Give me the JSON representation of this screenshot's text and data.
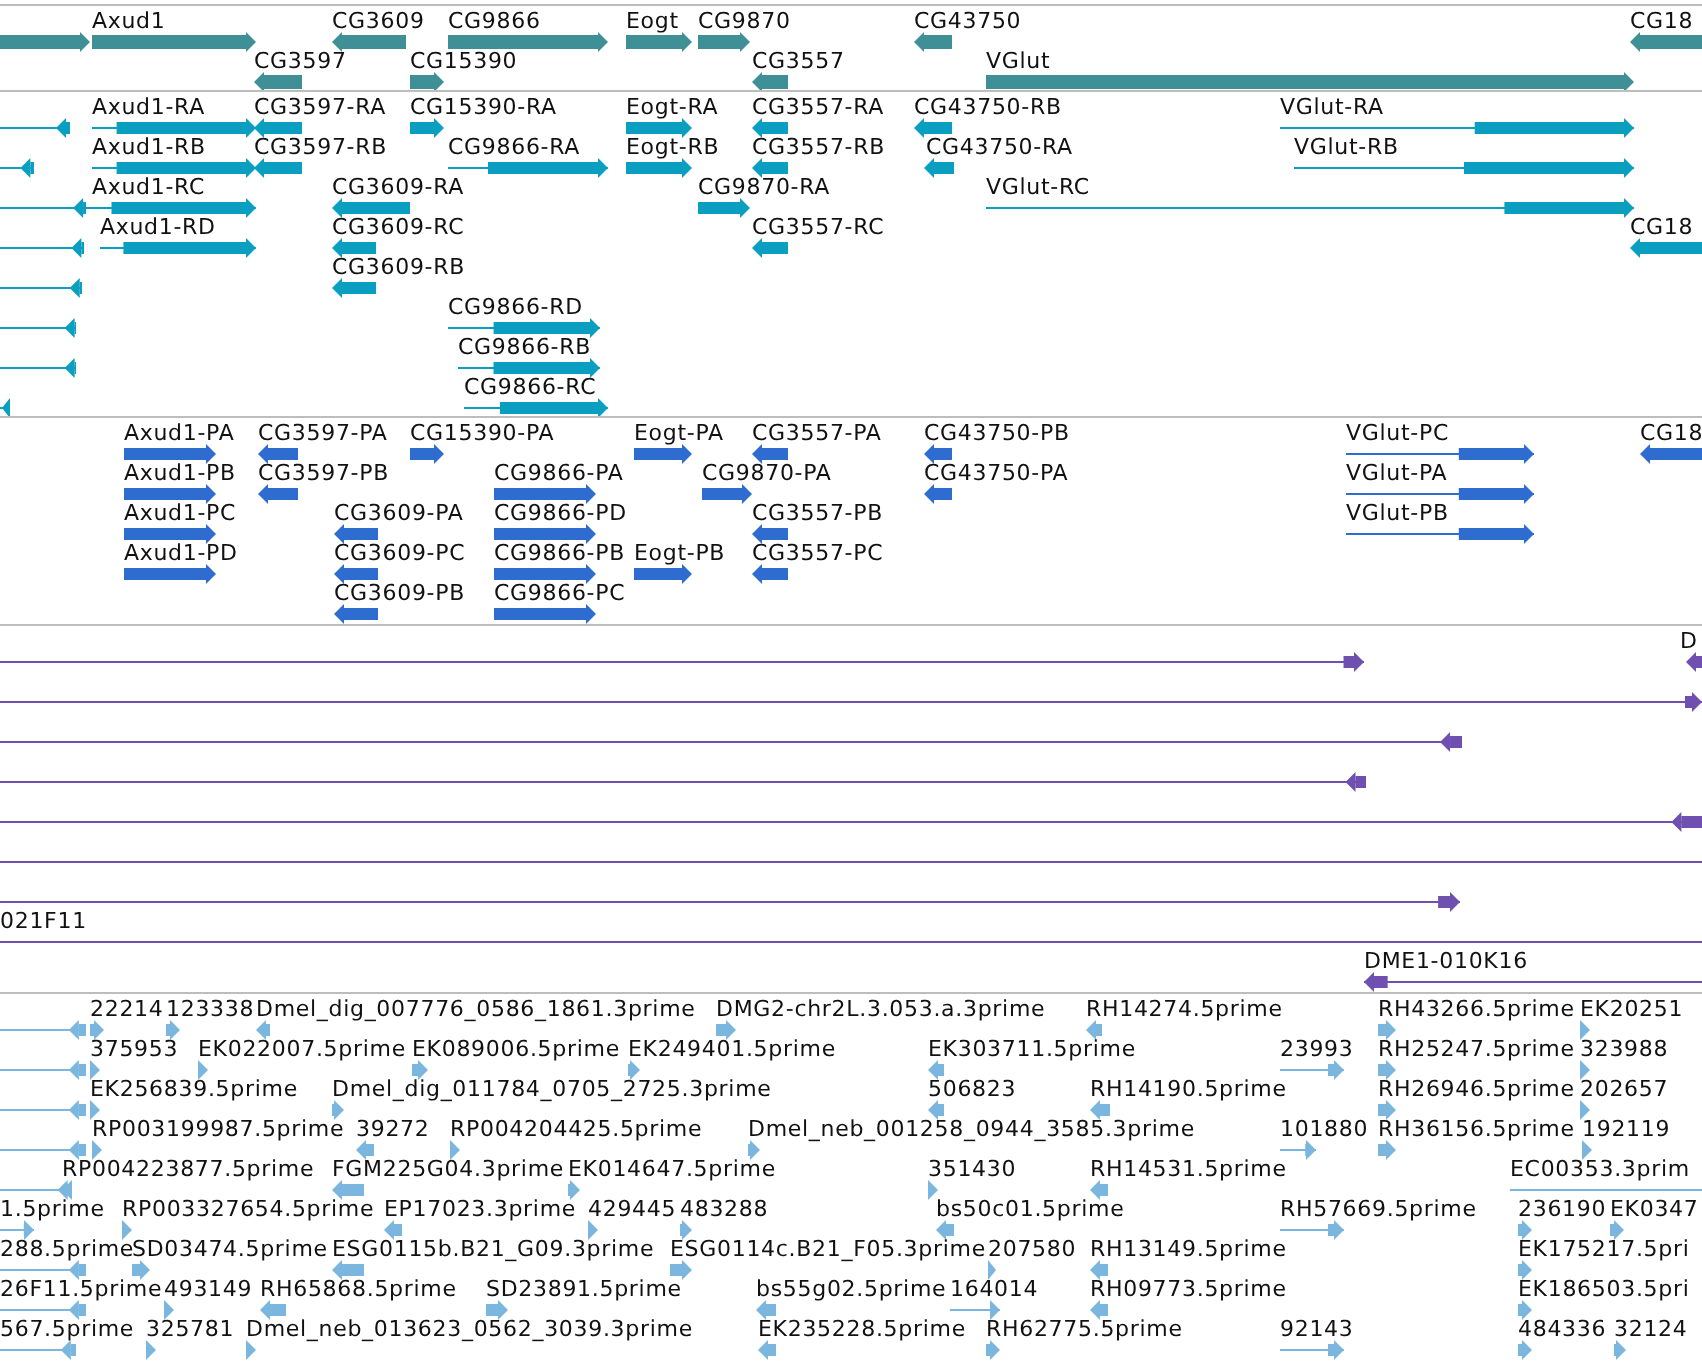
{
  "tracks": [
    {
      "kind": "gene",
      "color": "#3e8f96",
      "features": [
        {
          "reverse": false
        },
        {
          "label": "Axud1",
          "reverse": false
        },
        {
          "label": "CG3597",
          "reverse": true
        },
        {
          "label": "CG3609",
          "reverse": true
        },
        {
          "label": "CG15390",
          "reverse": false
        },
        {
          "label": "CG9866",
          "reverse": false
        },
        {
          "label": "Eogt",
          "reverse": false
        },
        {
          "label": "CG9870",
          "reverse": false
        },
        {
          "label": "CG3557",
          "reverse": true
        },
        {
          "label": "CG43750",
          "reverse": true
        },
        {
          "label": "VGlut",
          "reverse": false
        },
        {
          "label": "CG18",
          "reverse": true
        }
      ]
    },
    {
      "kind": "transcript",
      "color": "#0a9fc0",
      "features": [
        {
          "reverse": true
        },
        {
          "reverse": true
        },
        {
          "reverse": true
        },
        {
          "reverse": true
        },
        {
          "reverse": true
        },
        {
          "reverse": true
        },
        {
          "reverse": true
        },
        {
          "reverse": true
        },
        {
          "label": "Axud1-RA",
          "reverse": false
        },
        {
          "label": "CG3597-RA",
          "reverse": true
        },
        {
          "label": "CG15390-RA",
          "reverse": false
        },
        {
          "label": "Eogt-RA",
          "reverse": false
        },
        {
          "label": "CG3557-RA",
          "reverse": true
        },
        {
          "label": "CG43750-RB",
          "reverse": true
        },
        {
          "label": "VGlut-RA",
          "reverse": false
        },
        {
          "label": "Axud1-RB",
          "reverse": false
        },
        {
          "label": "CG3597-RB",
          "reverse": true
        },
        {
          "label": "CG9866-RA",
          "reverse": false
        },
        {
          "label": "Eogt-RB",
          "reverse": false
        },
        {
          "label": "CG3557-RB",
          "reverse": true
        },
        {
          "label": "CG43750-RA",
          "reverse": true
        },
        {
          "label": "VGlut-RB",
          "reverse": false
        },
        {
          "label": "Axud1-RC",
          "reverse": false
        },
        {
          "label": "CG3609-RA",
          "reverse": true
        },
        {
          "label": "CG9870-RA",
          "reverse": false
        },
        {
          "label": "VGlut-RC",
          "reverse": false
        },
        {
          "label": "Axud1-RD",
          "reverse": false
        },
        {
          "label": "CG3609-RC",
          "reverse": true
        },
        {
          "label": "CG3557-RC",
          "reverse": true
        },
        {
          "label": "CG18",
          "reverse": true
        },
        {
          "label": "CG3609-RB",
          "reverse": true
        },
        {
          "label": "CG9866-RD",
          "reverse": false
        },
        {
          "label": "CG9866-RB",
          "reverse": false
        },
        {
          "label": "CG9866-RC",
          "reverse": false
        }
      ]
    },
    {
      "kind": "protein",
      "color": "#2f6ccf",
      "features": [
        {
          "label": "Axud1-PA",
          "reverse": false
        },
        {
          "label": "CG3597-PA",
          "reverse": true
        },
        {
          "label": "CG15390-PA",
          "reverse": false
        },
        {
          "label": "Eogt-PA",
          "reverse": false
        },
        {
          "label": "CG3557-PA",
          "reverse": true
        },
        {
          "label": "CG43750-PB",
          "reverse": true
        },
        {
          "label": "VGlut-PC",
          "reverse": false
        },
        {
          "label": "CG18",
          "reverse": true
        },
        {
          "label": "Axud1-PB",
          "reverse": false
        },
        {
          "label": "CG3597-PB",
          "reverse": true
        },
        {
          "label": "CG9866-PA",
          "reverse": false
        },
        {
          "label": "CG9870-PA",
          "reverse": false
        },
        {
          "label": "CG43750-PA",
          "reverse": true
        },
        {
          "label": "VGlut-PA",
          "reverse": false
        },
        {
          "label": "Axud1-PC",
          "reverse": false
        },
        {
          "label": "CG3609-PA",
          "reverse": true
        },
        {
          "label": "CG9866-PD",
          "reverse": false
        },
        {
          "label": "CG3557-PB",
          "reverse": true
        },
        {
          "label": "VGlut-PB",
          "reverse": false
        },
        {
          "label": "Axud1-PD",
          "reverse": false
        },
        {
          "label": "CG3609-PC",
          "reverse": true
        },
        {
          "label": "CG9866-PB",
          "reverse": false
        },
        {
          "label": "Eogt-PB",
          "reverse": false
        },
        {
          "label": "CG3557-PC",
          "reverse": true
        },
        {
          "label": "CG3609-PB",
          "reverse": true
        },
        {
          "label": "CG9866-PC",
          "reverse": false
        }
      ]
    },
    {
      "kind": "clone",
      "color": "#6f4fb0",
      "features": [
        {
          "kind": "capped",
          "reverse": false
        },
        {
          "kind": "capped",
          "label": "D",
          "reverse": true
        },
        {
          "kind": "capped",
          "reverse": false
        },
        {
          "kind": "capped",
          "reverse": true
        },
        {
          "kind": "capped",
          "reverse": true
        },
        {
          "kind": "capped",
          "reverse": true
        },
        {
          "kind": "plain"
        },
        {
          "kind": "capped",
          "reverse": false
        },
        {
          "kind": "plain",
          "label": "021F11"
        },
        {
          "kind": "capped",
          "label": "DME1-010K16",
          "reverse": true
        }
      ]
    },
    {
      "kind": "est",
      "color": "#7ab6de",
      "features": [
        {
          "reverse": true
        },
        {
          "reverse": true
        },
        {
          "reverse": true
        },
        {
          "reverse": true
        },
        {
          "reverse": true
        },
        {
          "label": "22214",
          "reverse": false
        },
        {
          "label": "123338",
          "reverse": false
        },
        {
          "label": "Dmel_dig_007776_0586_1861.3prime",
          "reverse": true
        },
        {
          "label": "DMG2-chr2L.3.053.a.3prime",
          "reverse": false
        },
        {
          "label": "RH14274.5prime",
          "reverse": true
        },
        {
          "label": "RH43266.5prime",
          "reverse": false
        },
        {
          "label": "EK20251",
          "reverse": false
        },
        {
          "label": "375953",
          "reverse": false
        },
        {
          "label": "EK022007.5prime",
          "reverse": false
        },
        {
          "label": "EK089006.5prime",
          "reverse": false
        },
        {
          "label": "EK249401.5prime",
          "reverse": false
        },
        {
          "label": "EK303711.5prime",
          "reverse": true
        },
        {
          "label": "23993",
          "reverse": false
        },
        {
          "label": "RH25247.5prime",
          "reverse": false
        },
        {
          "label": "323988",
          "reverse": false
        },
        {
          "label": "EK256839.5prime",
          "reverse": false
        },
        {
          "label": "Dmel_dig_011784_0705_2725.3prime",
          "reverse": false
        },
        {
          "label": "506823",
          "reverse": true
        },
        {
          "label": "RH14190.5prime",
          "reverse": true
        },
        {
          "label": "RH26946.5prime",
          "reverse": false
        },
        {
          "label": "202657",
          "reverse": false
        },
        {
          "label": "RP003199987.5prime",
          "reverse": false
        },
        {
          "label": "39272",
          "reverse": true
        },
        {
          "label": "RP004204425.5prime",
          "reverse": false
        },
        {
          "label": "Dmel_neb_001258_0944_3585.3prime",
          "reverse": false
        },
        {
          "label": "101880",
          "reverse": false
        },
        {
          "label": "RH36156.5prime",
          "reverse": false
        },
        {
          "label": "192119",
          "reverse": false
        },
        {
          "label": "RP004223877.5prime",
          "reverse": true
        },
        {
          "label": "FGM225G04.3prime",
          "reverse": true
        },
        {
          "label": "EK014647.5prime",
          "reverse": false
        },
        {
          "label": "351430",
          "reverse": false
        },
        {
          "label": "RH14531.5prime",
          "reverse": true
        },
        {
          "label": "EC00353.3prim"
        },
        {
          "label": "1.5prime",
          "reverse": false
        },
        {
          "label": "RP003327654.5prime",
          "reverse": false
        },
        {
          "label": "EP17023.3prime",
          "reverse": true
        },
        {
          "label": "429445",
          "reverse": false
        },
        {
          "label": "483288",
          "reverse": false
        },
        {
          "label": "bs50c01.5prime",
          "reverse": true
        },
        {
          "label": "RH57669.5prime",
          "reverse": false
        },
        {
          "label": "236190",
          "reverse": false
        },
        {
          "label": "EK0347",
          "reverse": false
        },
        {
          "label": "288.5prime",
          "reverse": true
        },
        {
          "label": "SD03474.5prime",
          "reverse": false
        },
        {
          "label": "ESG0115b.B21_G09.3prime",
          "reverse": true
        },
        {
          "label": "ESG0114c.B21_F05.3prime",
          "reverse": false
        },
        {
          "label": "207580",
          "reverse": false
        },
        {
          "label": "RH13149.5prime",
          "reverse": true
        },
        {
          "label": "EK175217.5pri",
          "reverse": false
        },
        {
          "label": "26F11.5prime",
          "reverse": true
        },
        {
          "label": "493149",
          "reverse": false
        },
        {
          "label": "RH65868.5prime",
          "reverse": true
        },
        {
          "label": "SD23891.5prime",
          "reverse": false
        },
        {
          "label": "bs55g02.5prime",
          "reverse": true
        },
        {
          "label": "164014",
          "reverse": false
        },
        {
          "label": "RH09773.5prime",
          "reverse": true
        },
        {
          "label": "EK186503.5pri",
          "reverse": false
        },
        {
          "label": "567.5prime",
          "reverse": true
        },
        {
          "label": "325781",
          "reverse": false
        },
        {
          "label": "Dmel_neb_013623_0562_3039.3prime",
          "reverse": false
        },
        {
          "label": "EK235228.5prime",
          "reverse": true
        },
        {
          "label": "RH62775.5prime",
          "reverse": false
        },
        {
          "label": "92143",
          "reverse": false
        },
        {
          "label": "484336",
          "reverse": false
        },
        {
          "label": "32124",
          "reverse": false
        }
      ]
    }
  ]
}
